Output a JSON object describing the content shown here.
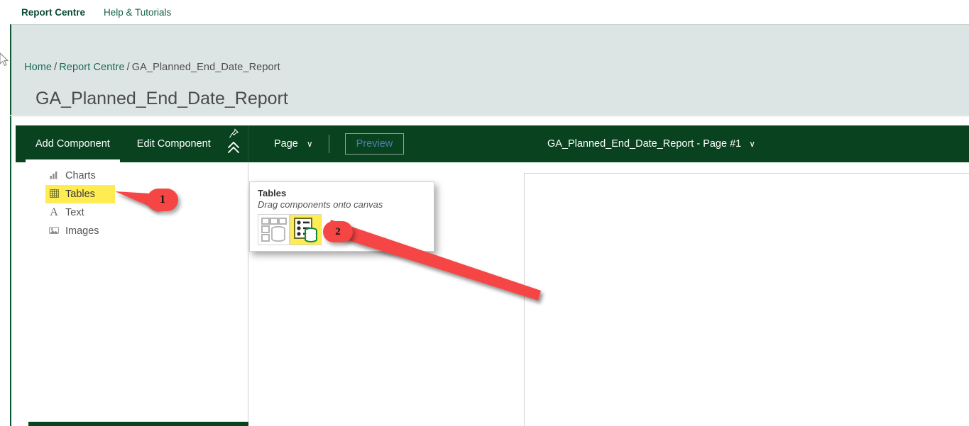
{
  "topnav": {
    "items": [
      {
        "label": "Report Centre"
      },
      {
        "label": "Help & Tutorials"
      }
    ]
  },
  "breadcrumb": {
    "home": "Home",
    "sep1": "/",
    "section": "Report Centre",
    "sep2": "/",
    "current": "GA_Planned_End_Date_Report"
  },
  "page": {
    "title": "GA_Planned_End_Date_Report"
  },
  "toolbar": {
    "tab_add_component": "Add Component",
    "tab_edit_component": "Edit Component",
    "pin_icon": "pin-icon",
    "collapse_icon": "chevron-double-up-icon",
    "page_menu": "Page",
    "page_menu_caret": "∨",
    "preview_button": "Preview",
    "report_page_label": "GA_Planned_End_Date_Report - Page #1",
    "report_page_caret": "∨",
    "bg_color": "#08421f",
    "active_tab": "Add Component"
  },
  "sidebar": {
    "items": [
      {
        "label": "Charts",
        "icon": "bar-chart-icon",
        "selected": false
      },
      {
        "label": "Tables",
        "icon": "table-grid-icon",
        "selected": true
      },
      {
        "label": "Text",
        "icon": "text-A-icon",
        "selected": false
      },
      {
        "label": "Images",
        "icon": "image-icon",
        "selected": false
      }
    ],
    "highlight_color": "#ffeb52"
  },
  "flyout": {
    "title": "Tables",
    "subtitle": "Drag components onto canvas",
    "components": [
      {
        "name": "table-layout-db-icon",
        "selected": false
      },
      {
        "name": "list-detail-db-icon",
        "selected": true
      }
    ]
  },
  "annotations": [
    {
      "id": "1",
      "label": "1",
      "color": "#f64545",
      "target": "sidebar-item-tables"
    },
    {
      "id": "2",
      "label": "2",
      "color": "#f64545",
      "target": "flyout-component-2"
    }
  ],
  "canvas": {
    "empty": true
  }
}
